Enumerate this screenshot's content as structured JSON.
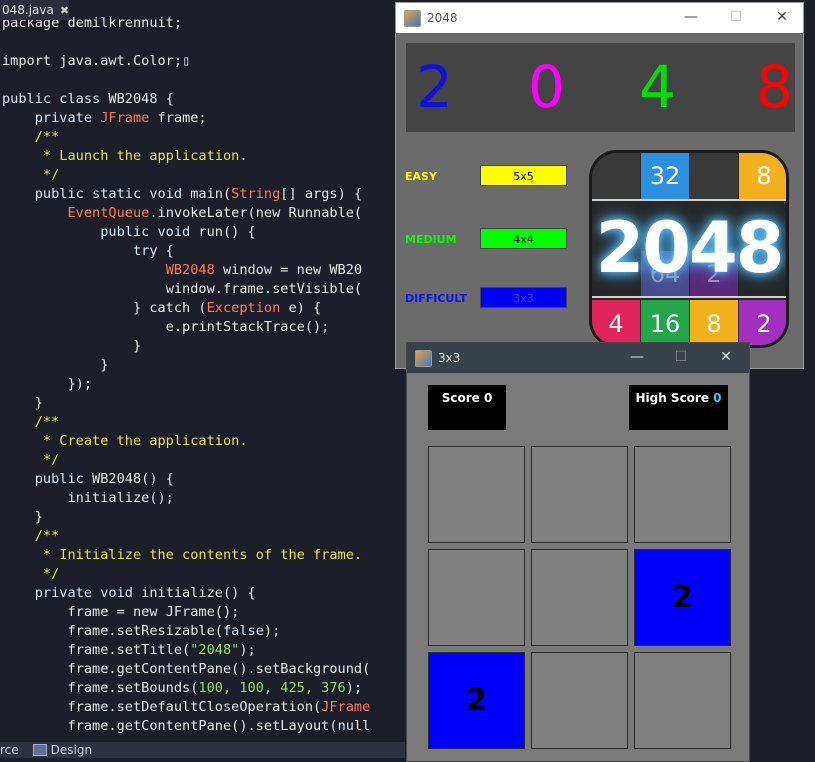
{
  "editor": {
    "tab_name": "048.java",
    "lines": [
      [
        [
          "package demilkrennuit;",
          ""
        ]
      ],
      [],
      [
        [
          "import java.awt.Color;",
          ""
        ],
        [
          "▯",
          "kw"
        ]
      ],
      [],
      [
        [
          "public class ",
          "kw"
        ],
        [
          "WB2048",
          ""
        ],
        [
          " {",
          ""
        ]
      ],
      [
        [
          "    private ",
          "kw"
        ],
        [
          "JFrame",
          "ty"
        ],
        [
          " frame;",
          ""
        ]
      ],
      [
        [
          "    /**",
          "cm"
        ]
      ],
      [
        [
          "     * Launch the application.",
          "cm"
        ]
      ],
      [
        [
          "     */",
          "cm"
        ]
      ],
      [
        [
          "    public static void ",
          "kw"
        ],
        [
          "main(",
          ""
        ],
        [
          "String",
          "ty"
        ],
        [
          "[] args) {",
          ""
        ]
      ],
      [
        [
          "        ",
          "kw"
        ],
        [
          "EventQueue",
          "ty"
        ],
        [
          ".invokeLater(new Runnable(",
          ""
        ]
      ],
      [
        [
          "            public void ",
          "kw"
        ],
        [
          "run() {",
          ""
        ]
      ],
      [
        [
          "                try {",
          "kw"
        ]
      ],
      [
        [
          "                    ",
          "kw"
        ],
        [
          "WB2048",
          "ty"
        ],
        [
          " window = new WB20",
          ""
        ]
      ],
      [
        [
          "                    ",
          ""
        ],
        [
          "window.frame.setVisible(",
          ""
        ]
      ],
      [
        [
          "                } catch (",
          ""
        ],
        [
          "Exception",
          "ex"
        ],
        [
          " e) {",
          ""
        ]
      ],
      [
        [
          "                    e.printStackTrace();",
          ""
        ]
      ],
      [
        [
          "                }",
          ""
        ]
      ],
      [
        [
          "            }",
          ""
        ]
      ],
      [
        [
          "        });",
          ""
        ]
      ],
      [
        [
          "    }",
          ""
        ]
      ],
      [
        [
          "    /**",
          "cm"
        ]
      ],
      [
        [
          "     * Create the application.",
          "cm"
        ]
      ],
      [
        [
          "     */",
          "cm"
        ]
      ],
      [
        [
          "    public ",
          "kw"
        ],
        [
          "WB2048() {",
          ""
        ]
      ],
      [
        [
          "        initialize();",
          ""
        ]
      ],
      [
        [
          "    }",
          ""
        ]
      ],
      [
        [
          "    /**",
          "cm"
        ]
      ],
      [
        [
          "     * Initialize the contents of the frame.",
          "cm"
        ]
      ],
      [
        [
          "     */",
          "cm"
        ]
      ],
      [
        [
          "    private void ",
          "kw"
        ],
        [
          "initialize() {",
          ""
        ]
      ],
      [
        [
          "        frame = new ",
          ""
        ],
        [
          "JFrame();",
          ""
        ]
      ],
      [
        [
          "        frame.setResizable(",
          ""
        ],
        [
          "false",
          "kw"
        ],
        [
          ");",
          ""
        ]
      ],
      [
        [
          "        frame.setTitle(",
          ""
        ],
        [
          "\"2048\"",
          "st"
        ],
        [
          ");",
          ""
        ]
      ],
      [
        [
          "        frame.getContentPane().setBackground(",
          ""
        ]
      ],
      [
        [
          "        frame.setBounds(",
          ""
        ],
        [
          "100, 100, 425, 376",
          "st"
        ],
        [
          ");",
          ""
        ]
      ],
      [
        [
          "        frame.setDefaultCloseOperation(",
          ""
        ],
        [
          "JFrame",
          "ty"
        ]
      ],
      [
        [
          "        frame.getContentPane().setLayout(",
          ""
        ],
        [
          "null",
          "kw"
        ]
      ]
    ],
    "bottom_tabs": {
      "source": "rce",
      "design": "Design"
    }
  },
  "win2048": {
    "title": "2048",
    "controls": {
      "minimize": "—",
      "maximize": "☐",
      "close": "✕"
    },
    "banner_digits": [
      {
        "text": "2",
        "color": "#1010e0"
      },
      {
        "text": "0",
        "color": "#ff00ff"
      },
      {
        "text": "4",
        "color": "#00e000"
      },
      {
        "text": "8",
        "color": "#ff0000"
      }
    ],
    "levels": [
      {
        "label": "EASY",
        "label_color": "#ffff00",
        "button": "5x5",
        "button_color": "#ffff00"
      },
      {
        "label": "MEDIUM",
        "label_color": "#00ff00",
        "button": "4x4",
        "button_color": "#00ff00"
      },
      {
        "label": "DIFFICULT",
        "label_color": "#1010ff",
        "button": "3x3",
        "button_color": "#0000ff"
      }
    ],
    "logo": {
      "text": "2048",
      "top_tiles": [
        {
          "text": "",
          "color": "#3a3a3a"
        },
        {
          "text": "32",
          "color": "#2d8fe0"
        },
        {
          "text": "",
          "color": "#3a3a3a"
        },
        {
          "text": "8",
          "color": "#f2b01c"
        }
      ],
      "hidden_tiles": [
        "64",
        "2"
      ],
      "bottom_tiles": [
        {
          "text": "4",
          "color": "#e0245e"
        },
        {
          "text": "16",
          "color": "#22a84a"
        },
        {
          "text": "8",
          "color": "#f2b01c"
        },
        {
          "text": "2",
          "color": "#a22fc0"
        }
      ]
    }
  },
  "win3x3": {
    "title": "3x3",
    "controls": {
      "minimize": "—",
      "maximize": "☐",
      "close": "✕"
    },
    "score_label": "Score",
    "score_value": "0",
    "high_label": "High Score",
    "high_value": "0",
    "grid": [
      [
        "",
        "",
        ""
      ],
      [
        "",
        "",
        "2"
      ],
      [
        "2",
        "",
        ""
      ]
    ],
    "tile_color": "#0000ff",
    "empty_color": "#808080"
  }
}
